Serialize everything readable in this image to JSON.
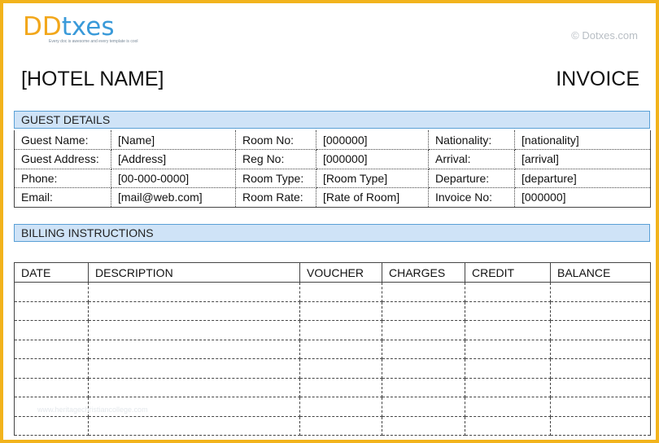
{
  "logo": {
    "word_part1": "D",
    "word_part2": "D",
    "word_part3": "txes",
    "tagline": "Every doc is awesome and every template is cool"
  },
  "copyright": "© Dotxes.com",
  "header": {
    "hotel_name": "[HOTEL NAME]",
    "doc_title": "INVOICE"
  },
  "guest_section": {
    "title": "GUEST DETAILS"
  },
  "guest_rows": [
    [
      "Guest Name:",
      "[Name]",
      "Room No:",
      "[000000]",
      "Nationality:",
      "[nationality]"
    ],
    [
      "Guest Address:",
      "[Address]",
      "Reg No:",
      "[000000]",
      "Arrival:",
      "[arrival]"
    ],
    [
      "Phone:",
      "[00-000-0000]",
      "Room Type:",
      "[Room Type]",
      "Departure:",
      "[departure]"
    ],
    [
      "Email:",
      "[mail@web.com]",
      "Room Rate:",
      "[Rate of Room]",
      "Invoice No:",
      "[000000]"
    ]
  ],
  "billing_section": {
    "title": "BILLING INSTRUCTIONS"
  },
  "billing_columns": [
    "DATE",
    "DESCRIPTION",
    "VOUCHER",
    "CHARGES",
    "CREDIT",
    "BALANCE"
  ],
  "billing_empty_rows": 8,
  "watermark": "www.heritagechristiancollege.com",
  "colors": {
    "frame": "#f2b31c",
    "section_bar": "#cfe3f7",
    "section_border": "#5aa0d6",
    "logo_orange": "#f2a71b",
    "logo_blue": "#3a9ad9"
  }
}
